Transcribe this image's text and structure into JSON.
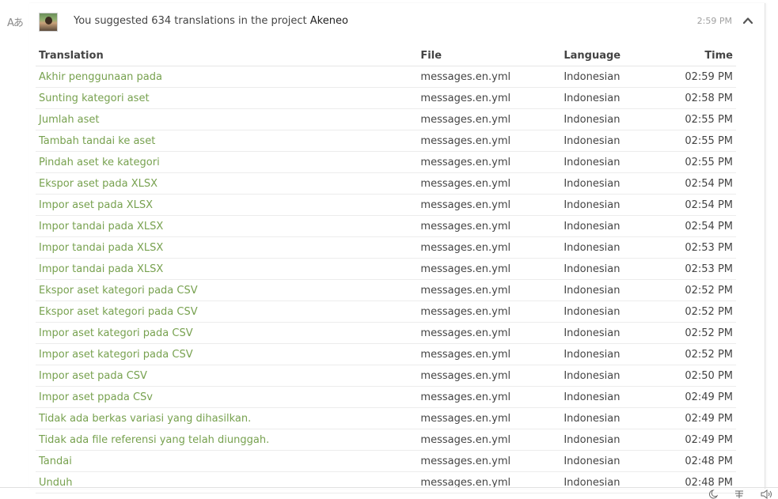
{
  "sidebar": {
    "icon": "translate-icon",
    "icon_glyph": "Aあ"
  },
  "activity": {
    "summary_prefix": "You suggested 634 translations in the project",
    "project": "Akeneo",
    "time": "2:59 PM"
  },
  "table": {
    "headers": {
      "translation": "Translation",
      "file": "File",
      "language": "Language",
      "time": "Time"
    },
    "rows": [
      {
        "translation": "Akhir penggunaan pada",
        "file": "messages.en.yml",
        "language": "Indonesian",
        "time": "02:59 PM"
      },
      {
        "translation": "Sunting kategori aset",
        "file": "messages.en.yml",
        "language": "Indonesian",
        "time": "02:58 PM"
      },
      {
        "translation": "Jumlah aset",
        "file": "messages.en.yml",
        "language": "Indonesian",
        "time": "02:55 PM"
      },
      {
        "translation": "Tambah tandai ke aset",
        "file": "messages.en.yml",
        "language": "Indonesian",
        "time": "02:55 PM"
      },
      {
        "translation": "Pindah aset ke kategori",
        "file": "messages.en.yml",
        "language": "Indonesian",
        "time": "02:55 PM"
      },
      {
        "translation": "Ekspor aset pada XLSX",
        "file": "messages.en.yml",
        "language": "Indonesian",
        "time": "02:54 PM"
      },
      {
        "translation": "Impor aset pada XLSX",
        "file": "messages.en.yml",
        "language": "Indonesian",
        "time": "02:54 PM"
      },
      {
        "translation": "Impor tandai pada XLSX",
        "file": "messages.en.yml",
        "language": "Indonesian",
        "time": "02:54 PM"
      },
      {
        "translation": "Impor tandai pada XLSX",
        "file": "messages.en.yml",
        "language": "Indonesian",
        "time": "02:53 PM"
      },
      {
        "translation": "Impor tandai pada XLSX",
        "file": "messages.en.yml",
        "language": "Indonesian",
        "time": "02:53 PM"
      },
      {
        "translation": "Ekspor aset kategori pada CSV",
        "file": "messages.en.yml",
        "language": "Indonesian",
        "time": "02:52 PM"
      },
      {
        "translation": "Ekspor aset kategori pada CSV",
        "file": "messages.en.yml",
        "language": "Indonesian",
        "time": "02:52 PM"
      },
      {
        "translation": "Impor aset kategori pada CSV",
        "file": "messages.en.yml",
        "language": "Indonesian",
        "time": "02:52 PM"
      },
      {
        "translation": "Impor aset kategori pada CSV",
        "file": "messages.en.yml",
        "language": "Indonesian",
        "time": "02:52 PM"
      },
      {
        "translation": "Impor aset pada CSV",
        "file": "messages.en.yml",
        "language": "Indonesian",
        "time": "02:50 PM"
      },
      {
        "translation": "Impor aset ppada CSv",
        "file": "messages.en.yml",
        "language": "Indonesian",
        "time": "02:49 PM"
      },
      {
        "translation": "Tidak ada berkas variasi yang dihasilkan.",
        "file": "messages.en.yml",
        "language": "Indonesian",
        "time": "02:49 PM"
      },
      {
        "translation": "Tidak ada file referensi yang telah diunggah.",
        "file": "messages.en.yml",
        "language": "Indonesian",
        "time": "02:49 PM"
      },
      {
        "translation": "Tandai",
        "file": "messages.en.yml",
        "language": "Indonesian",
        "time": "02:48 PM"
      },
      {
        "translation": "Unduh",
        "file": "messages.en.yml",
        "language": "Indonesian",
        "time": "02:48 PM"
      }
    ]
  },
  "footer": {
    "icons": [
      "moon-icon",
      "keyboard-icon",
      "speaker-icon"
    ]
  },
  "colors": {
    "link": "#77a14f",
    "muted": "#a0a0a0",
    "text": "#444444"
  }
}
